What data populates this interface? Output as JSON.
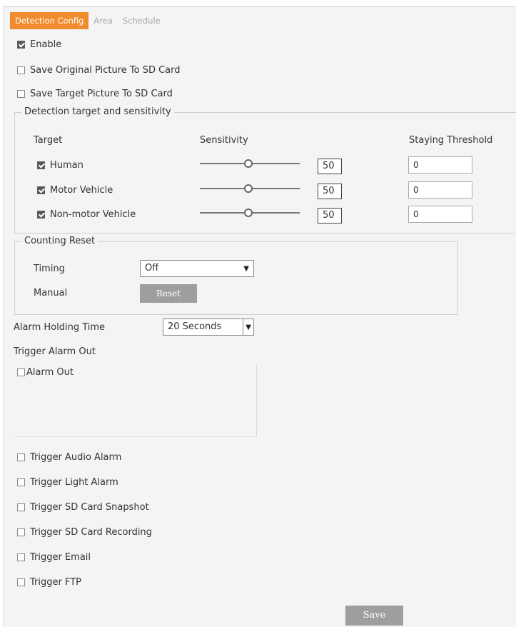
{
  "tabs": [
    {
      "label": "Detection Config",
      "active": true
    },
    {
      "label": "Area",
      "active": false
    },
    {
      "label": "Schedule",
      "active": false
    }
  ],
  "options": {
    "enable": {
      "label": "Enable",
      "checked": true
    },
    "save_original": {
      "label": "Save Original Picture To SD Card",
      "checked": false
    },
    "save_target": {
      "label": "Save Target Picture To SD Card",
      "checked": false
    }
  },
  "detection": {
    "legend": "Detection target and sensitivity",
    "col_target": "Target",
    "col_sensitivity": "Sensitivity",
    "col_threshold": "Staying Threshold",
    "rows": [
      {
        "label": "Human",
        "checked": true,
        "sensitivity": "50",
        "threshold": "0"
      },
      {
        "label": "Motor Vehicle",
        "checked": true,
        "sensitivity": "50",
        "threshold": "0"
      },
      {
        "label": "Non-motor Vehicle",
        "checked": true,
        "sensitivity": "50",
        "threshold": "0"
      }
    ]
  },
  "counting": {
    "legend": "Counting Reset",
    "timing_label": "Timing",
    "timing_value": "Off",
    "manual_label": "Manual",
    "reset_label": "Reset"
  },
  "alarm": {
    "holding_label": "Alarm Holding Time",
    "holding_value": "20 Seconds",
    "trigger_out_label": "Trigger Alarm Out",
    "alarm_out_label": "Alarm Out"
  },
  "triggers": [
    {
      "label": "Trigger Audio Alarm",
      "checked": false
    },
    {
      "label": "Trigger Light Alarm",
      "checked": false
    },
    {
      "label": "Trigger SD Card Snapshot",
      "checked": false
    },
    {
      "label": "Trigger SD Card Recording",
      "checked": false
    },
    {
      "label": "Trigger Email",
      "checked": false
    },
    {
      "label": "Trigger FTP",
      "checked": false
    }
  ],
  "save_label": "Save",
  "colors": {
    "accent": "#f08c2e",
    "button": "#9e9e9e",
    "background": "#f4f4f4"
  }
}
